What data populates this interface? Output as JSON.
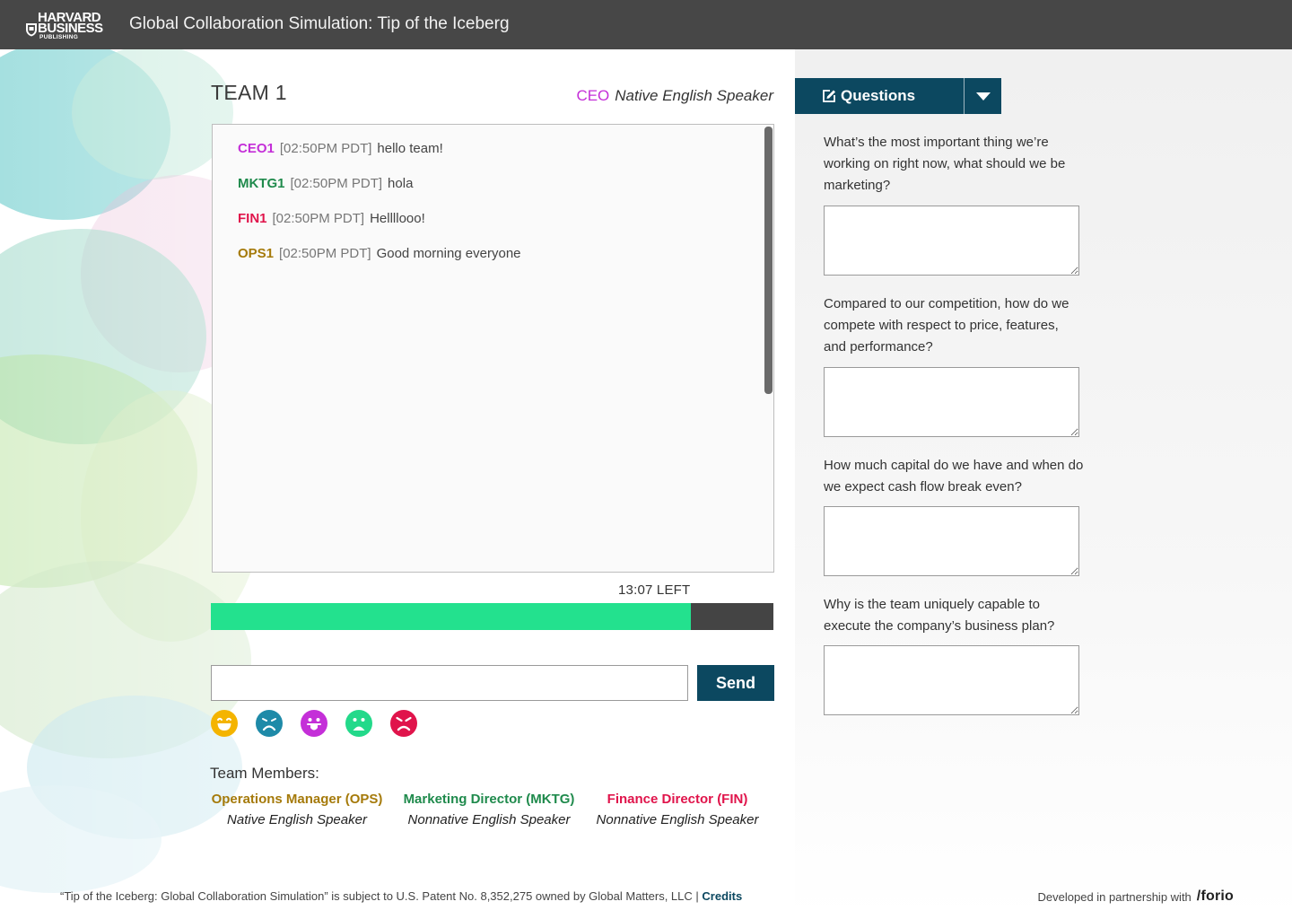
{
  "header": {
    "logo": [
      "HARVARD",
      "BUSINESS",
      "PUBLISHING"
    ],
    "title": "Global Collaboration Simulation: Tip of the Iceberg"
  },
  "team": {
    "title": "TEAM 1",
    "my_role": "CEO",
    "my_language": "Native English Speaker"
  },
  "chat": {
    "messages": [
      {
        "who": "CEO1",
        "time": "[02:50PM PDT]",
        "text": "hello team!",
        "color": "#c42fd8"
      },
      {
        "who": "MKTG1",
        "time": "[02:50PM PDT]",
        "text": "hola",
        "color": "#1f8a4c"
      },
      {
        "who": "FIN1",
        "time": "[02:50PM PDT]",
        "text": "Hellllooo!",
        "color": "#e0144b"
      },
      {
        "who": "OPS1",
        "time": "[02:50PM PDT]",
        "text": "Good morning everyone",
        "color": "#a57a0a"
      }
    ]
  },
  "timer": {
    "label": "13:07 LEFT",
    "fraction_remaining": 0.853,
    "fill_color": "#23e18e"
  },
  "composer": {
    "value": "",
    "send_label": "Send"
  },
  "emojis": [
    {
      "name": "grinning-face-icon",
      "color": "#f4b400"
    },
    {
      "name": "sad-face-icon",
      "color": "#1e8aa8"
    },
    {
      "name": "tongue-out-face-icon",
      "color": "#c42fd8"
    },
    {
      "name": "frowning-face-icon",
      "color": "#23d98a"
    },
    {
      "name": "angry-face-icon",
      "color": "#e0144b"
    }
  ],
  "members": {
    "title": "Team Members:",
    "list": [
      {
        "name": "Operations Manager (OPS)",
        "language": "Native English Speaker",
        "color": "#a57a0a"
      },
      {
        "name": "Marketing Director (MKTG)",
        "language": "Nonnative English Speaker",
        "color": "#1f8a4c"
      },
      {
        "name": "Finance Director (FIN)",
        "language": "Nonnative English Speaker",
        "color": "#e0144b"
      }
    ]
  },
  "questions_panel": {
    "button_label": "Questions",
    "items": [
      {
        "text": "What’s the most important thing we’re working on right now, what should we be marketing?",
        "answer": ""
      },
      {
        "text": "Compared to our competition, how do we compete with respect to price, features, and performance?",
        "answer": ""
      },
      {
        "text": "How much capital do we have and when do we expect cash flow break even?",
        "answer": ""
      },
      {
        "text": "Why is the team uniquely capable to execute the company’s business plan?",
        "answer": ""
      }
    ]
  },
  "footer": {
    "patent_text": "“Tip of the Iceberg: Global Collaboration Simulation” is subject to U.S. Patent No. 8,352,275 owned by Global Matters, LLC |",
    "credits_label": "Credits",
    "partner_text": "Developed in partnership with",
    "partner_brand": "/forio"
  }
}
